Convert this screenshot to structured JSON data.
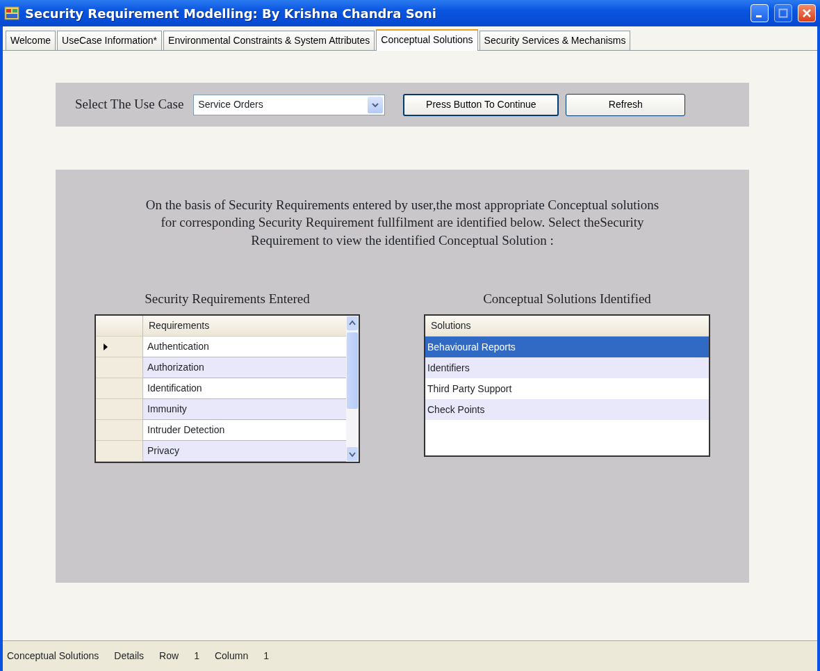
{
  "window": {
    "title": "Security Requirement Modelling: By Krishna Chandra Soni"
  },
  "tabs": [
    {
      "label": "Welcome",
      "selected": false
    },
    {
      "label": "UseCase Information*",
      "selected": false
    },
    {
      "label": "Environmental Constraints & System Attributes",
      "selected": false
    },
    {
      "label": "Conceptual Solutions",
      "selected": true
    },
    {
      "label": "Security Services & Mechanisms",
      "selected": false
    }
  ],
  "use_case": {
    "label": "Select The Use Case",
    "value": "Service Orders",
    "buttons": [
      "Press Button To Continue",
      "Refresh"
    ]
  },
  "description": "On the basis of Security Requirements entered by user,the most appropriate Conceptual solutions for corresponding Security Requirement fullfilment are identified below. Select theSecurity Requirement to view the identified Conceptual  Solution :",
  "requirements": {
    "heading": "Security Requirements Entered",
    "column": "Requirements",
    "rows": [
      {
        "text": "Authentication",
        "selected": true
      },
      {
        "text": "Authorization",
        "selected": false
      },
      {
        "text": "Identification",
        "selected": false
      },
      {
        "text": "Immunity",
        "selected": false
      },
      {
        "text": "Intruder Detection",
        "selected": false
      },
      {
        "text": "Privacy",
        "selected": false
      }
    ]
  },
  "solutions": {
    "heading": "Conceptual Solutions Identified",
    "column": "Solutions",
    "rows": [
      {
        "text": "Behavioural Reports",
        "selected": true
      },
      {
        "text": "Identifiers",
        "selected": false
      },
      {
        "text": "Third Party Support",
        "selected": false
      },
      {
        "text": "Check Points",
        "selected": false
      }
    ]
  },
  "status_bar": [
    "Conceptual Solutions",
    "Details",
    "Row",
    "1",
    "Column",
    "1"
  ]
}
